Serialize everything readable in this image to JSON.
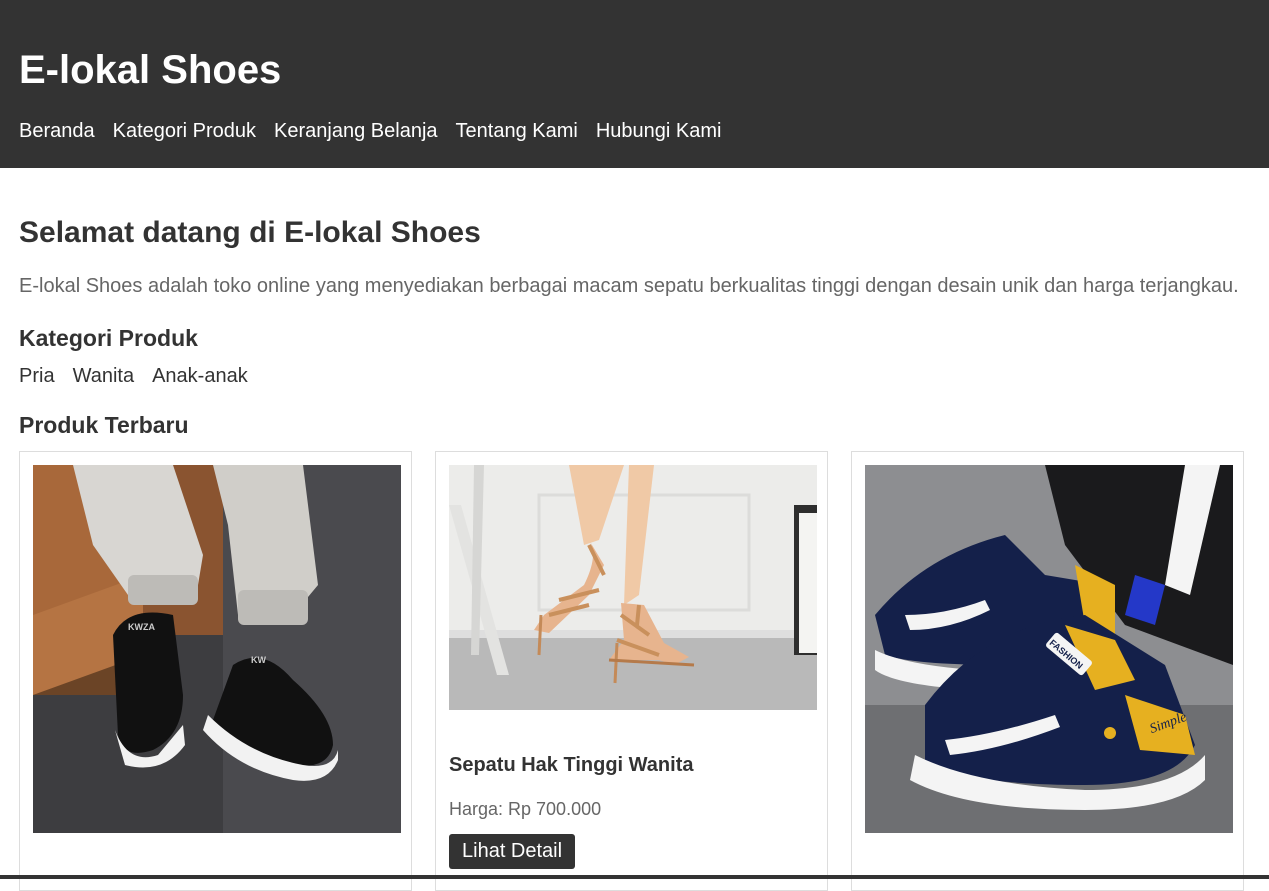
{
  "header": {
    "site_title": "E-lokal Shoes",
    "nav": [
      {
        "label": "Beranda"
      },
      {
        "label": "Kategori Produk"
      },
      {
        "label": "Keranjang Belanja"
      },
      {
        "label": "Tentang Kami"
      },
      {
        "label": "Hubungi Kami"
      }
    ]
  },
  "main": {
    "welcome_title": "Selamat datang di E-lokal Shoes",
    "intro": "E-lokal Shoes adalah toko online yang menyediakan berbagai macam sepatu berkualitas tinggi dengan desain unik dan harga terjangkau.",
    "categories": {
      "title": "Kategori Produk",
      "items": [
        {
          "label": "Pria"
        },
        {
          "label": "Wanita"
        },
        {
          "label": "Anak-anak"
        }
      ]
    },
    "products": {
      "title": "Produk Terbaru",
      "items": [
        {
          "image": "black-sneakers-photo"
        },
        {
          "image": "womens-high-heel-sandals-photo",
          "name": "Sepatu Hak Tinggi Wanita",
          "price": "Harga: Rp 700.000",
          "button_label": "Lihat Detail"
        },
        {
          "image": "kids-navy-yellow-sneakers-photo"
        }
      ]
    }
  },
  "colors": {
    "header_bg": "#333333",
    "header_text": "#ffffff",
    "heading_text": "#333333",
    "body_text": "#666666",
    "button_bg": "#333333",
    "card_border": "#dddddd"
  }
}
